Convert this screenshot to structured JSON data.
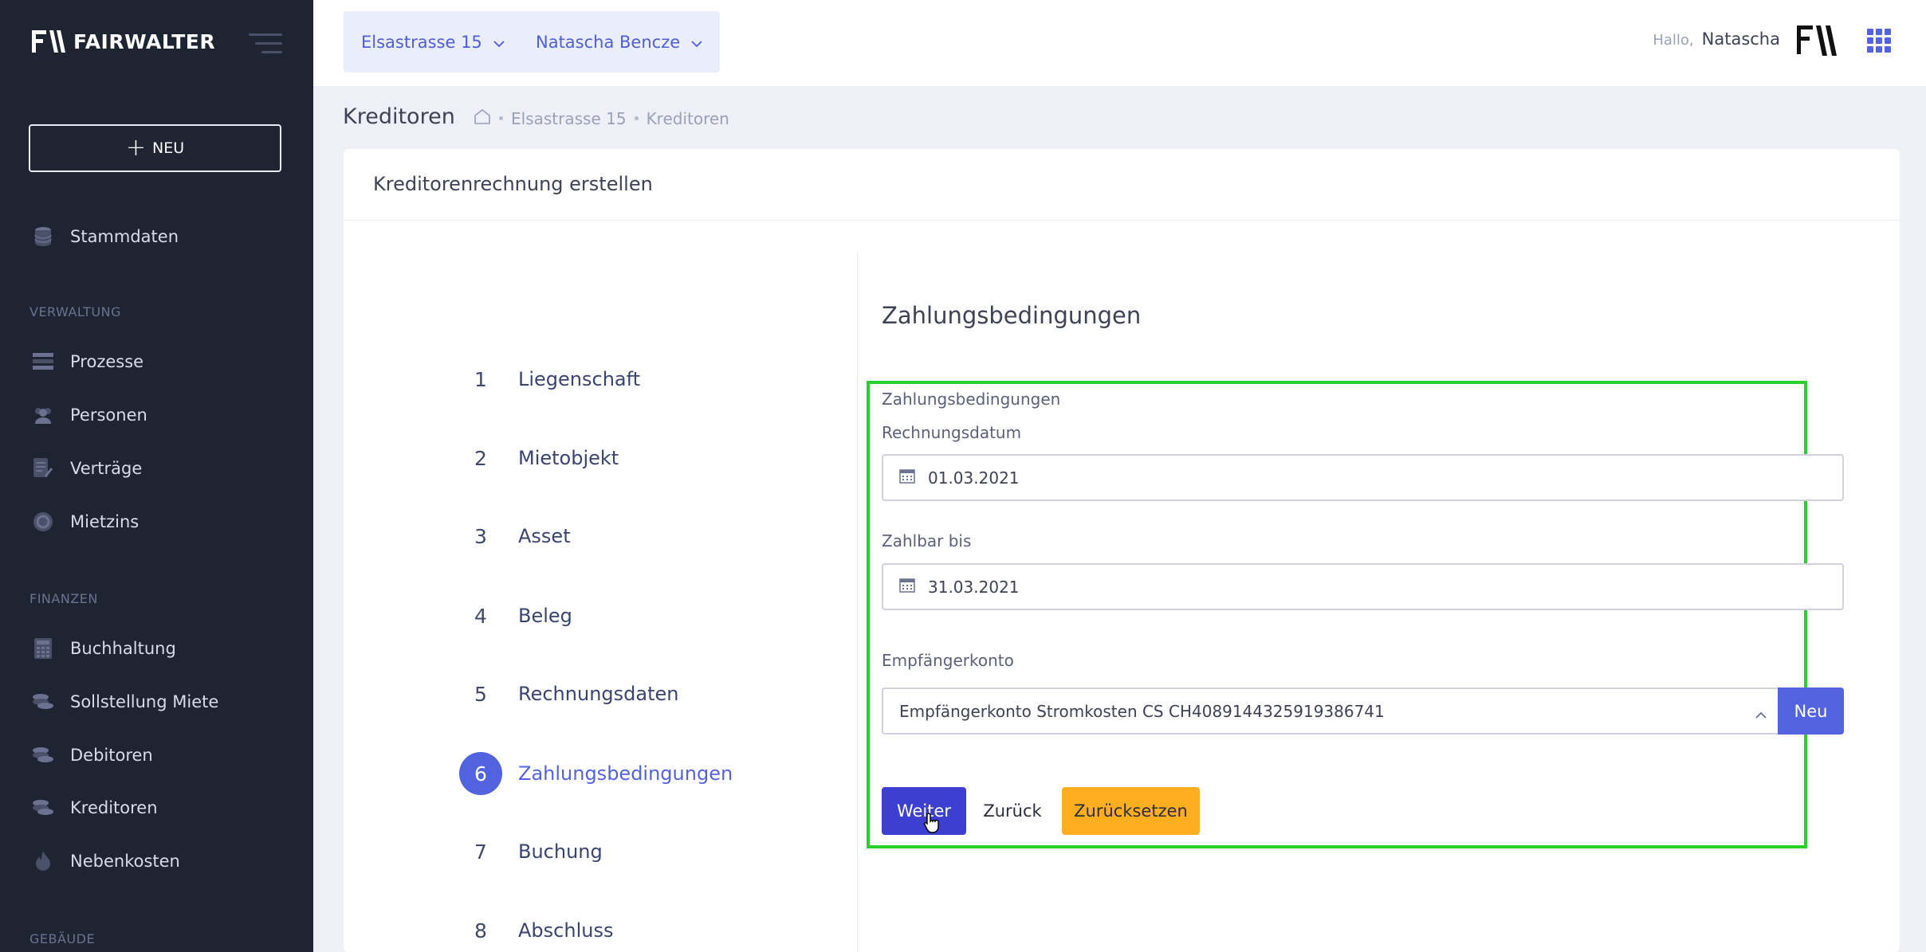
{
  "brand": {
    "name": "FAIRWALTER"
  },
  "sidebar": {
    "new_label": "NEU",
    "items_top": [
      {
        "label": "Stammdaten",
        "icon": "database-icon"
      }
    ],
    "section_verwaltung": "VERWALTUNG",
    "verwaltung": [
      {
        "label": "Prozesse",
        "icon": "list-icon"
      },
      {
        "label": "Personen",
        "icon": "users-icon"
      },
      {
        "label": "Verträge",
        "icon": "contract-icon"
      },
      {
        "label": "Mietzins",
        "icon": "coin-icon"
      }
    ],
    "section_finanzen": "FINANZEN",
    "finanzen": [
      {
        "label": "Buchhaltung",
        "icon": "calculator-icon"
      },
      {
        "label": "Sollstellung Miete",
        "icon": "coins-icon"
      },
      {
        "label": "Debitoren",
        "icon": "coins-icon"
      },
      {
        "label": "Kreditoren",
        "icon": "coins-icon"
      },
      {
        "label": "Nebenkosten",
        "icon": "flame-icon"
      }
    ],
    "section_gebaeude": "GEBÄUDE"
  },
  "header": {
    "property_dropdown": "Elsastrasse 15",
    "person_dropdown": "Natascha Bencze",
    "greeting": "Hallo,",
    "user_name": "Natascha"
  },
  "breadcrumb": {
    "title": "Kreditoren",
    "items": [
      "Elsastrasse 15",
      "Kreditoren"
    ]
  },
  "card": {
    "title": "Kreditorenrechnung erstellen",
    "steps": [
      {
        "num": "1",
        "label": "Liegenschaft"
      },
      {
        "num": "2",
        "label": "Mietobjekt"
      },
      {
        "num": "3",
        "label": "Asset"
      },
      {
        "num": "4",
        "label": "Beleg"
      },
      {
        "num": "5",
        "label": "Rechnungsdaten"
      },
      {
        "num": "6",
        "label": "Zahlungsbedingungen"
      },
      {
        "num": "7",
        "label": "Buchung"
      },
      {
        "num": "8",
        "label": "Abschluss"
      }
    ],
    "active_step": "6"
  },
  "form": {
    "section_title": "Zahlungsbedingungen",
    "group_label": "Zahlungsbedingungen",
    "rechnungsdatum_label": "Rechnungsdatum",
    "rechnungsdatum_value": "01.03.2021",
    "zahlbar_label": "Zahlbar bis",
    "zahlbar_value": "31.03.2021",
    "empfaenger_label": "Empfängerkonto",
    "empfaenger_value": "Empfängerkonto Stromkosten CS CH4089144325919386741",
    "neu_label": "Neu",
    "weiter_label": "Weiter",
    "zurueck_label": "Zurück",
    "reset_label": "Zurücksetzen"
  },
  "colors": {
    "accent": "#5363e0",
    "highlight": "#2bd12b",
    "warning": "#ffae1f",
    "sidebar": "#1f2433"
  }
}
